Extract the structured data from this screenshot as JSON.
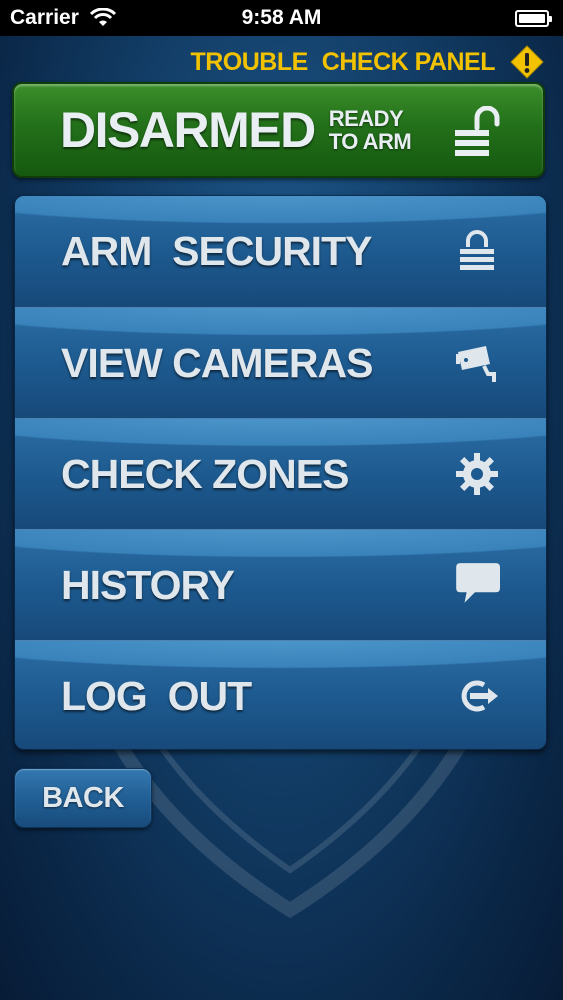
{
  "status_bar": {
    "carrier": "Carrier",
    "time": "9:58 AM"
  },
  "trouble": {
    "word1": "TROUBLE",
    "word2": "CHECK PANEL",
    "icon": "warning-icon"
  },
  "arm_status": {
    "state": "DISARMED",
    "detail_line1": "READY",
    "detail_line2": "TO ARM",
    "icon": "unlocked-padlock-icon",
    "color": "#23701a"
  },
  "menu": {
    "items": [
      {
        "label": "ARM  SECURITY",
        "icon": "padlock-icon"
      },
      {
        "label": "VIEW CAMERAS",
        "icon": "camera-icon"
      },
      {
        "label": "CHECK ZONES",
        "icon": "gear-icon"
      },
      {
        "label": "HISTORY",
        "icon": "chat-bubble-icon"
      },
      {
        "label": "LOG  OUT",
        "icon": "logout-icon"
      }
    ]
  },
  "back": {
    "label": "BACK"
  },
  "colors": {
    "accent_yellow": "#f2c200",
    "menu_blue": "#2b6ea6",
    "background": "#123d66"
  }
}
